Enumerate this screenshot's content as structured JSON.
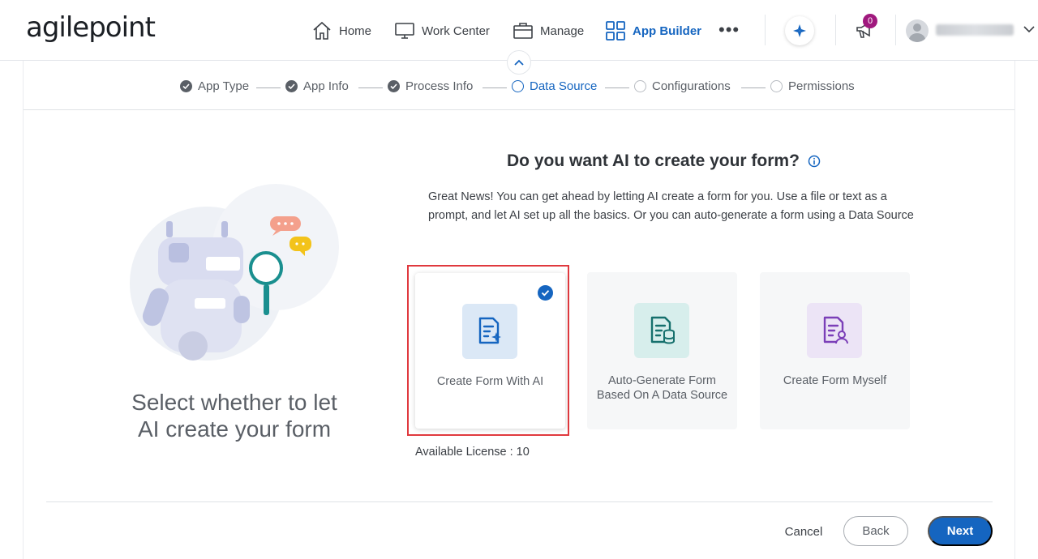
{
  "header": {
    "logo": "agilepoint",
    "nav": [
      {
        "label": "Home",
        "icon": "home-icon"
      },
      {
        "label": "Work Center",
        "icon": "monitor-icon"
      },
      {
        "label": "Manage",
        "icon": "briefcase-icon"
      },
      {
        "label": "App Builder",
        "icon": "grid-icon",
        "active": true
      }
    ],
    "more": "•••",
    "notification_count": "0"
  },
  "stepper": {
    "steps": [
      {
        "label": "App Type",
        "state": "done"
      },
      {
        "label": "App Info",
        "state": "done"
      },
      {
        "label": "Process Info",
        "state": "done"
      },
      {
        "label": "Data Source",
        "state": "current"
      },
      {
        "label": "Configurations",
        "state": "todo"
      },
      {
        "label": "Permissions",
        "state": "todo"
      }
    ]
  },
  "left": {
    "caption": "Select whether to let AI create your form"
  },
  "main": {
    "heading": "Do you want AI to create your form?",
    "description": "Great News! You can get ahead by letting AI create a form for you. Use a file or text as a prompt, and let AI set up all the basics. Or you can auto-generate a form using a Data Source",
    "options": [
      {
        "label": "Create Form With AI",
        "icon": "ai-form-icon",
        "selected": true
      },
      {
        "label": "Auto-Generate Form Based On A Data Source",
        "icon": "database-form-icon",
        "selected": false
      },
      {
        "label": "Create Form Myself",
        "icon": "user-form-icon",
        "selected": false
      }
    ],
    "license": "Available License : 10"
  },
  "footer": {
    "cancel": "Cancel",
    "back": "Back",
    "next": "Next"
  },
  "colors": {
    "accent": "#1565c0",
    "selection_outline": "#e0393e",
    "badge": "#a0197e"
  }
}
